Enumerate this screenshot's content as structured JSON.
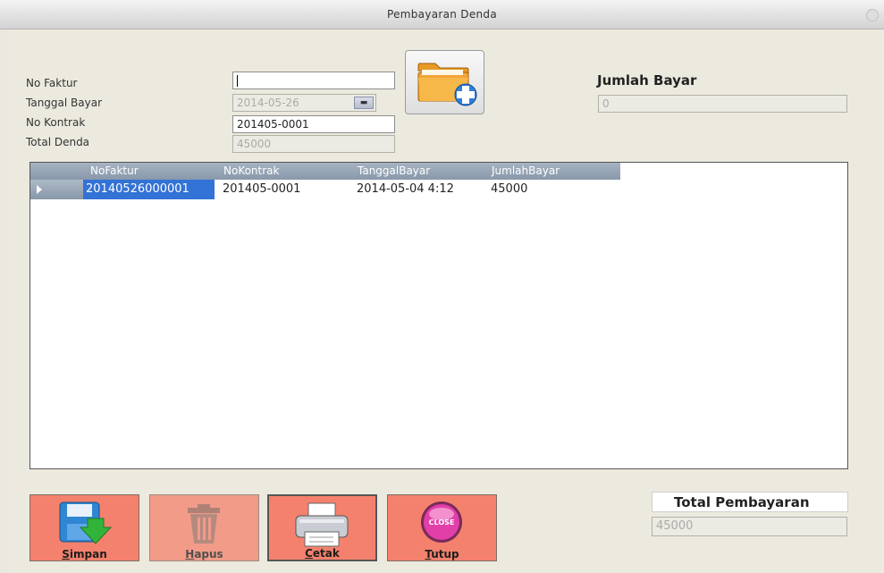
{
  "window": {
    "title": "Pembayaran Denda"
  },
  "form": {
    "no_faktur_label": "No Faktur",
    "tanggal_bayar_label": "Tanggal Bayar",
    "no_kontrak_label": "No Kontrak",
    "total_denda_label": "Total Denda",
    "no_faktur_value": "",
    "tanggal_bayar_value": "2014-05-26",
    "no_kontrak_value": "201405-0001",
    "total_denda_value": "45000"
  },
  "jumlah_bayar": {
    "label": "Jumlah Bayar",
    "value": "0"
  },
  "grid": {
    "columns": [
      "NoFaktur",
      "NoKontrak",
      "TanggalBayar",
      "JumlahBayar"
    ],
    "rows": [
      [
        "20140526000001",
        "201405-0001",
        "2014-05-04 4:12",
        "45000"
      ]
    ]
  },
  "buttons": {
    "simpan": {
      "first": "S",
      "rest": "impan"
    },
    "hapus": {
      "first": "H",
      "rest": "apus"
    },
    "cetak": {
      "first": "C",
      "rest": "etak"
    },
    "tutup": {
      "first": "T",
      "rest": "utup"
    },
    "close_badge": "CLOSE"
  },
  "total_pembayaran": {
    "label": "Total Pembayaran",
    "value": "45000"
  },
  "icons": {
    "folder": "folder-add-icon",
    "save": "floppy-disk-icon",
    "delete": "trash-icon",
    "print": "printer-icon",
    "close": "close-badge-icon"
  },
  "colors": {
    "button_bg": "#f4816d",
    "selection": "#3372d6",
    "grid_header": "#8898aa"
  }
}
